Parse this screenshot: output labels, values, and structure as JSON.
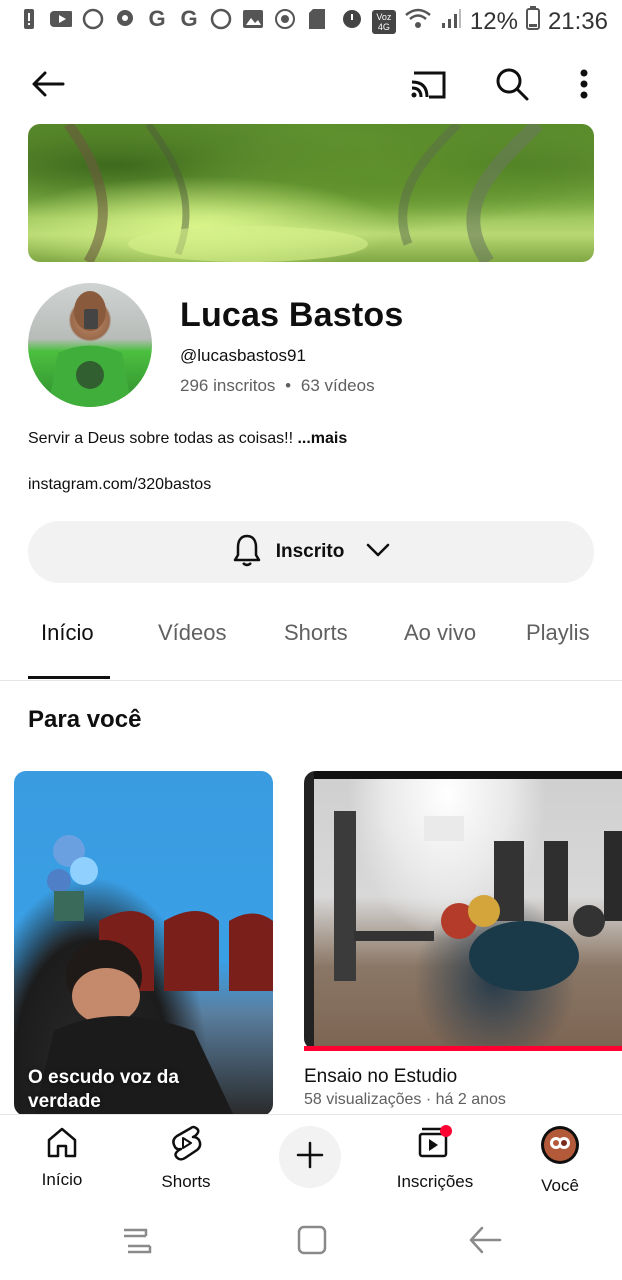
{
  "status_bar": {
    "battery": "12%",
    "time": "21:36",
    "network": "Voz 4G",
    "left_icons": [
      "alert-icon",
      "youtube-icon",
      "whatsapp-icon",
      "chat-icon",
      "google-icon",
      "google-icon",
      "whatsapp-icon",
      "gallery-icon",
      "camera-icon",
      "sd-card-icon"
    ]
  },
  "topbar": {
    "icons": [
      "back-arrow-icon",
      "cast-icon",
      "search-icon",
      "more-vert-icon"
    ]
  },
  "channel": {
    "name": "Lucas Bastos",
    "handle": "@lucasbastos91",
    "subscribers": "296 inscritos",
    "separator": "•",
    "videos": "63 vídeos",
    "description": "Servir a Deus sobre todas as coisas!!",
    "more": "...mais",
    "link": "instagram.com/320bastos",
    "subscribe_label": "Inscrito"
  },
  "tabs": [
    {
      "label": "Início",
      "active": true
    },
    {
      "label": "Vídeos",
      "active": false
    },
    {
      "label": "Shorts",
      "active": false
    },
    {
      "label": "Ao vivo",
      "active": false
    },
    {
      "label": "Playlis",
      "active": false
    }
  ],
  "section": {
    "title": "Para você"
  },
  "cards": {
    "short": {
      "title": "O escudo voz da verdade"
    },
    "video": {
      "title": "Ensaio no Estudio",
      "meta": "58 visualizações · há 2 anos"
    }
  },
  "bottom_nav": [
    {
      "label": "Início",
      "icon": "home-icon"
    },
    {
      "label": "Shorts",
      "icon": "shorts-icon"
    },
    {
      "label": "",
      "icon": "plus-icon"
    },
    {
      "label": "Inscrições",
      "icon": "subscriptions-icon"
    },
    {
      "label": "Você",
      "icon": "account-avatar-icon"
    }
  ],
  "colors": {
    "accent": "#ff0033",
    "text": "#0f0f0f",
    "secondary": "#606060",
    "chip_bg": "#f2f2f2"
  }
}
